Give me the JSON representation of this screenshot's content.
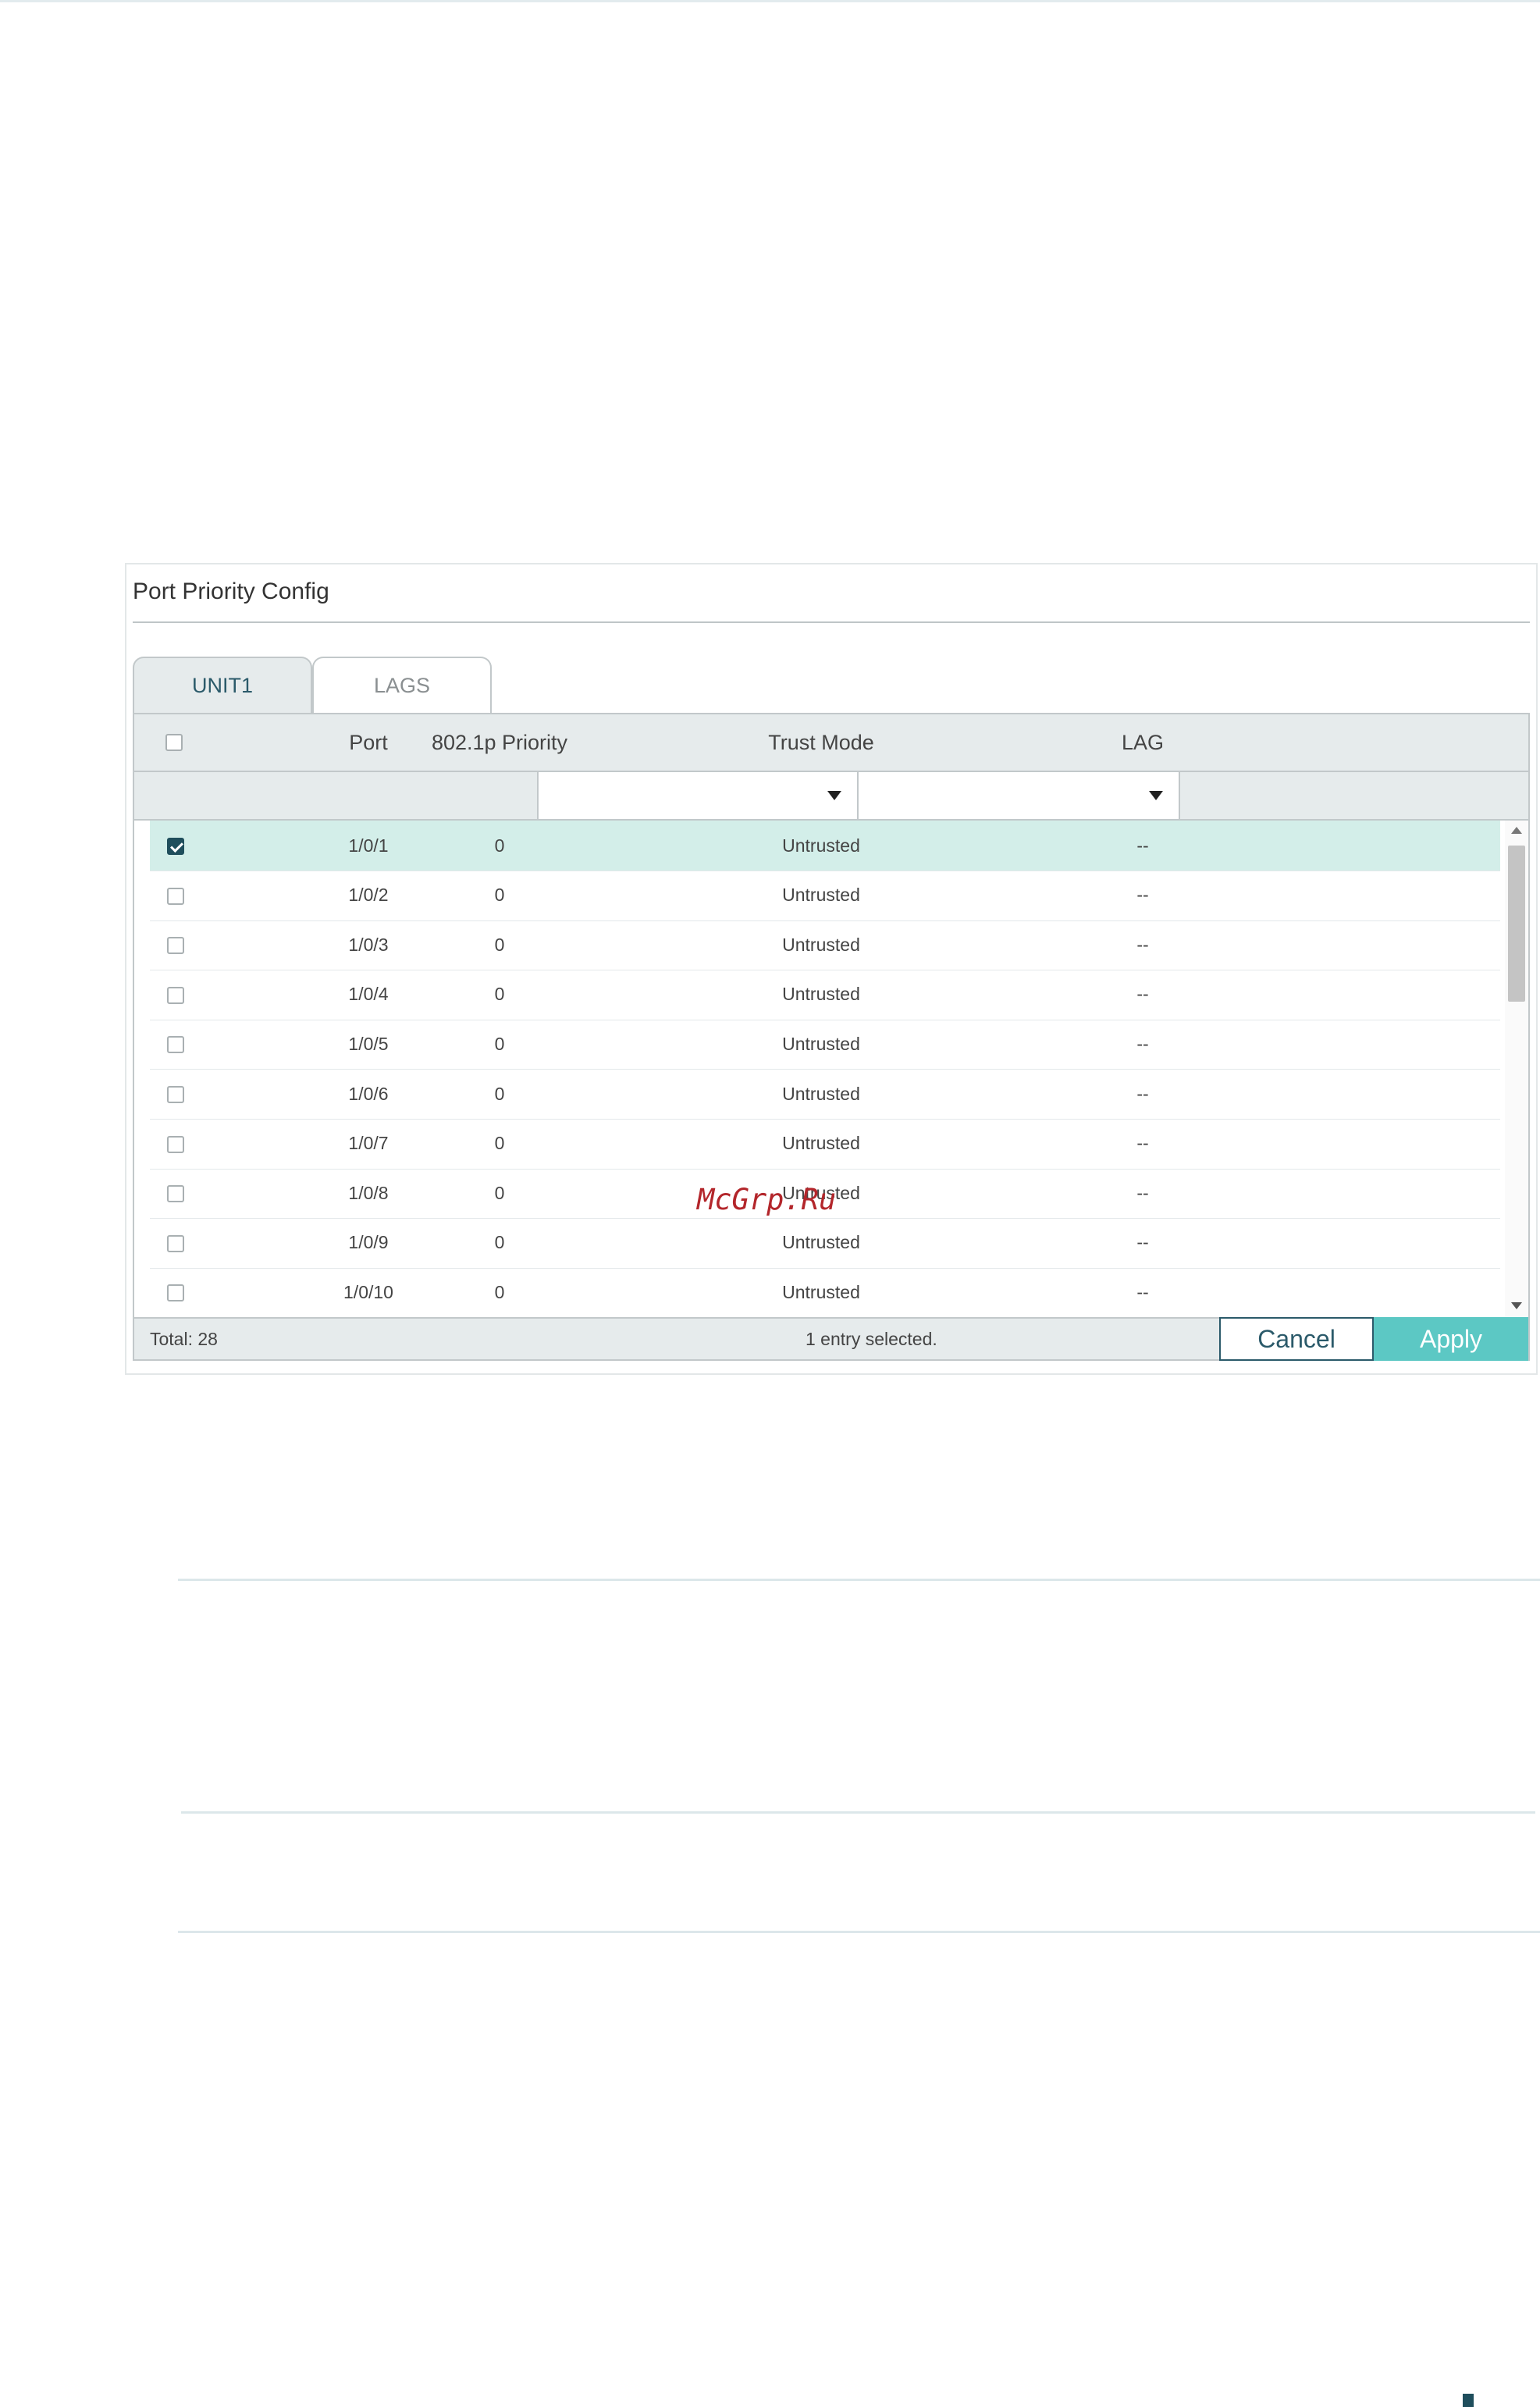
{
  "panel": {
    "title": "Port Priority Config",
    "tabs": [
      {
        "label": "UNIT1",
        "active": true
      },
      {
        "label": "LAGS",
        "active": false
      }
    ]
  },
  "table": {
    "columns": {
      "port": "Port",
      "priority": "802.1p Priority",
      "trust_mode": "Trust Mode",
      "lag": "LAG"
    },
    "rows": [
      {
        "checked": true,
        "port": "1/0/1",
        "priority": "0",
        "trust_mode": "Untrusted",
        "lag": "--"
      },
      {
        "checked": false,
        "port": "1/0/2",
        "priority": "0",
        "trust_mode": "Untrusted",
        "lag": "--"
      },
      {
        "checked": false,
        "port": "1/0/3",
        "priority": "0",
        "trust_mode": "Untrusted",
        "lag": "--"
      },
      {
        "checked": false,
        "port": "1/0/4",
        "priority": "0",
        "trust_mode": "Untrusted",
        "lag": "--"
      },
      {
        "checked": false,
        "port": "1/0/5",
        "priority": "0",
        "trust_mode": "Untrusted",
        "lag": "--"
      },
      {
        "checked": false,
        "port": "1/0/6",
        "priority": "0",
        "trust_mode": "Untrusted",
        "lag": "--"
      },
      {
        "checked": false,
        "port": "1/0/7",
        "priority": "0",
        "trust_mode": "Untrusted",
        "lag": "--"
      },
      {
        "checked": false,
        "port": "1/0/8",
        "priority": "0",
        "trust_mode": "Untrusted",
        "lag": "--"
      },
      {
        "checked": false,
        "port": "1/0/9",
        "priority": "0",
        "trust_mode": "Untrusted",
        "lag": "--"
      },
      {
        "checked": false,
        "port": "1/0/10",
        "priority": "0",
        "trust_mode": "Untrusted",
        "lag": "--"
      }
    ]
  },
  "footer": {
    "total": "Total: 28",
    "selection": "1 entry selected.",
    "cancel_label": "Cancel",
    "apply_label": "Apply"
  },
  "watermark": "McGrp.Ru",
  "colors": {
    "accent": "#5cc8c4",
    "dark_teal": "#1f4e5c",
    "selected_row": "#d3eee9",
    "header_bg": "#e6ebec",
    "watermark": "#b3262b"
  }
}
